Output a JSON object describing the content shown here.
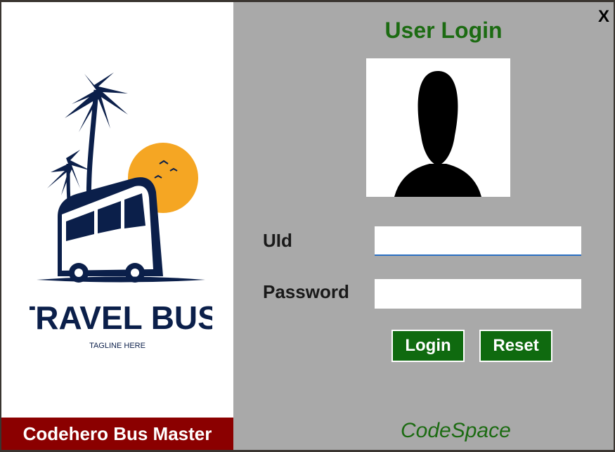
{
  "brand": {
    "logo_title": "TRAVEL BUS",
    "logo_tagline": "TAGLINE HERE",
    "name": "Codehero Bus Master"
  },
  "login": {
    "title": "User Login",
    "close_label": "X",
    "uid_label": "UId",
    "uid_value": "",
    "password_label": "Password",
    "password_value": "",
    "login_button": "Login",
    "reset_button": "Reset"
  },
  "footer": {
    "credit": "CodeSpace"
  },
  "colors": {
    "title_green": "#1c6b12",
    "button_green": "#0f6a0f",
    "brand_bar": "#8b0000",
    "panel_gray": "#a9a9a9",
    "logo_navy": "#0b1f4a",
    "logo_sun": "#f5a623"
  },
  "icons": {
    "avatar": "user-silhouette-icon",
    "logo": "travel-bus-logo"
  }
}
